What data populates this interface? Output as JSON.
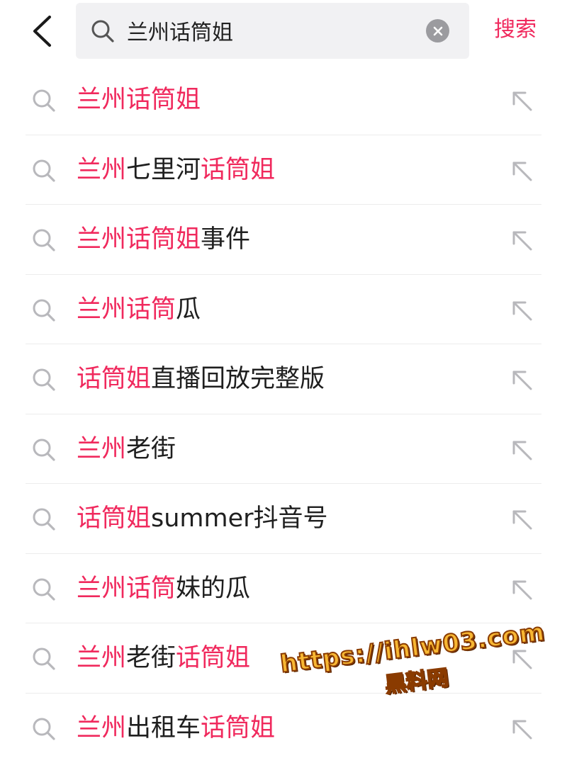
{
  "header": {
    "back_icon": "chevron-left-icon",
    "search": {
      "icon": "search-icon",
      "value": "兰州话筒姐",
      "clear_icon": "clear-circle-icon"
    },
    "search_button_label": "搜索",
    "accent_color": "#f0295d"
  },
  "suggestions": [
    {
      "segments": [
        {
          "text": "兰州话筒姐",
          "hl": true
        }
      ]
    },
    {
      "segments": [
        {
          "text": "兰州",
          "hl": true
        },
        {
          "text": "七里河",
          "hl": false
        },
        {
          "text": "话筒姐",
          "hl": true
        }
      ]
    },
    {
      "segments": [
        {
          "text": "兰州话筒姐",
          "hl": true
        },
        {
          "text": "事件",
          "hl": false
        }
      ]
    },
    {
      "segments": [
        {
          "text": "兰州话筒",
          "hl": true
        },
        {
          "text": "瓜",
          "hl": false
        }
      ]
    },
    {
      "segments": [
        {
          "text": "话筒姐",
          "hl": true
        },
        {
          "text": "直播回放完整版",
          "hl": false
        }
      ]
    },
    {
      "segments": [
        {
          "text": "兰州",
          "hl": true
        },
        {
          "text": "老街",
          "hl": false
        }
      ]
    },
    {
      "segments": [
        {
          "text": "话筒姐",
          "hl": true
        },
        {
          "text": "summer抖音号",
          "hl": false
        }
      ]
    },
    {
      "segments": [
        {
          "text": "兰州话筒",
          "hl": true
        },
        {
          "text": "妹的瓜",
          "hl": false
        }
      ]
    },
    {
      "segments": [
        {
          "text": "兰州",
          "hl": true
        },
        {
          "text": "老街",
          "hl": false
        },
        {
          "text": "话筒姐",
          "hl": true
        }
      ]
    },
    {
      "segments": [
        {
          "text": "兰州",
          "hl": true
        },
        {
          "text": "出租车",
          "hl": false
        },
        {
          "text": "话筒姐",
          "hl": true
        }
      ]
    }
  ],
  "row_icons": {
    "leading": "search-icon",
    "trailing": "fill-query-arrow-icon"
  },
  "watermark": {
    "url": "https://ihlw03.com",
    "name": "黑料网"
  },
  "colors": {
    "text": "#1f1f1f",
    "highlight": "#f0295d",
    "icon_gray": "#b8b8bc",
    "search_bg": "#f1f1f3"
  }
}
